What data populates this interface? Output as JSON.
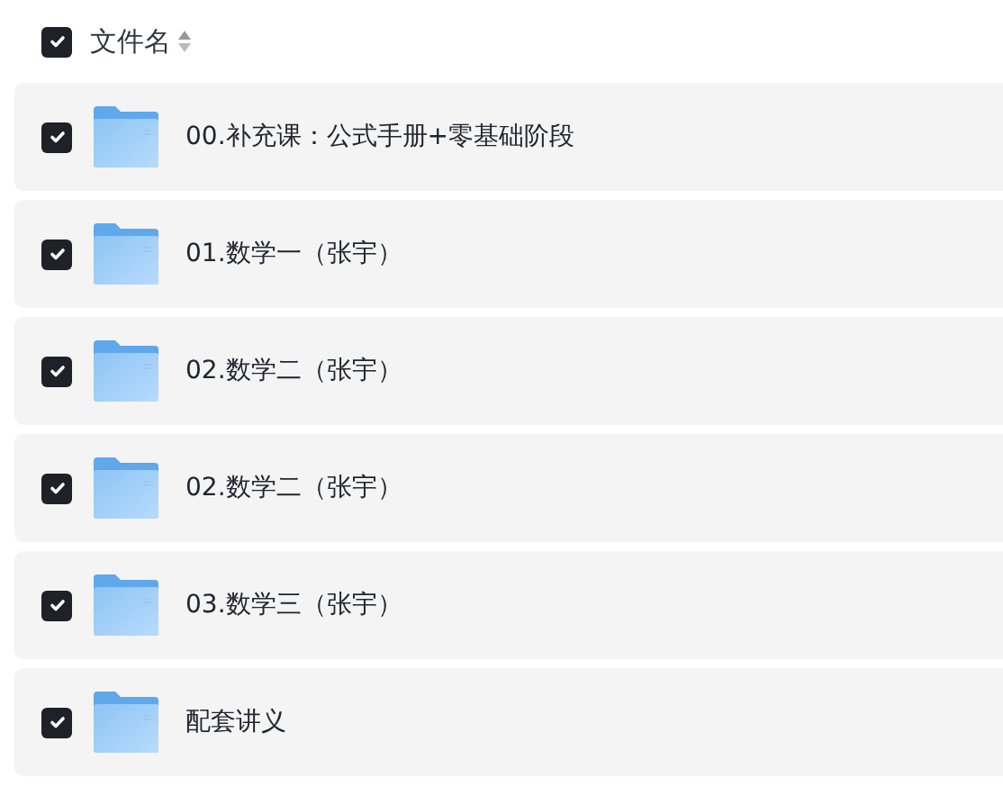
{
  "header": {
    "label": "文件名",
    "checked": true
  },
  "files": [
    {
      "name": "00.补充课：公式手册+零基础阶段",
      "checked": true
    },
    {
      "name": "01.数学一（张宇）",
      "checked": true
    },
    {
      "name": "02.数学二（张宇）",
      "checked": true
    },
    {
      "name": "02.数学二（张宇）",
      "checked": true
    },
    {
      "name": "03.数学三（张宇）",
      "checked": true
    },
    {
      "name": "配套讲义",
      "checked": true
    }
  ]
}
